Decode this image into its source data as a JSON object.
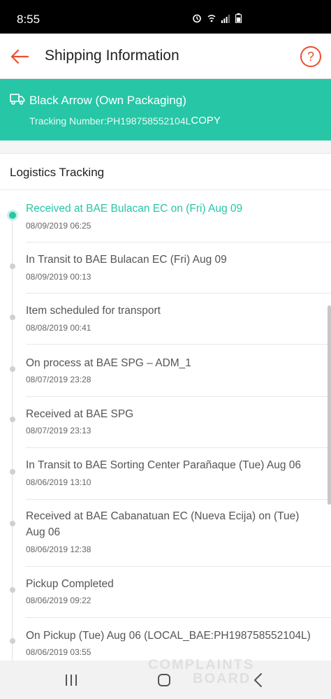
{
  "status_bar": {
    "time": "8:55",
    "icons": [
      "alarm-icon",
      "wifi-icon",
      "signal-icon",
      "battery-icon"
    ]
  },
  "header": {
    "title": "Shipping Information",
    "back_icon": "arrow-left-icon",
    "help_icon": "question-circle-icon",
    "help_label": "?"
  },
  "banner": {
    "carrier": "Black Arrow (Own Packaging)",
    "tracking_label": "Tracking Number: ",
    "tracking_number": "PH198758552104L",
    "copy_label": "COPY",
    "truck_icon": "truck-icon",
    "color": "#26c6a6"
  },
  "logistics": {
    "title": "Logistics Tracking",
    "events": [
      {
        "text": "Received at BAE Bulacan EC on (Fri) Aug 09",
        "time": "08/09/2019 06:25",
        "active": true
      },
      {
        "text": "In Transit to BAE Bulacan EC (Fri) Aug 09",
        "time": "08/09/2019 00:13",
        "active": false
      },
      {
        "text": "Item scheduled for transport",
        "time": "08/08/2019 00:41",
        "active": false
      },
      {
        "text": "On process at BAE SPG – ADM_1",
        "time": "08/07/2019 23:28",
        "active": false
      },
      {
        "text": "Received at BAE SPG",
        "time": "08/07/2019 23:13",
        "active": false
      },
      {
        "text": "In Transit to BAE Sorting Center Parañaque (Tue) Aug 06",
        "time": "08/06/2019 13:10",
        "active": false
      },
      {
        "text": "Received at BAE Cabanatuan EC (Nueva Ecija) on (Tue) Aug 06",
        "time": "08/06/2019 12:38",
        "active": false
      },
      {
        "text": "Pickup Completed",
        "time": "08/06/2019 09:22",
        "active": false
      },
      {
        "text": "On Pickup (Tue) Aug 06 (LOCAL_BAE:PH198758552104L)",
        "time": "08/06/2019 03:55",
        "active": false
      }
    ]
  },
  "watermark": {
    "line1": "COMPLAINTS",
    "line2": "BOARD"
  },
  "nav_bar": {
    "recents_icon": "recents-icon",
    "home_icon": "home-icon",
    "back_icon": "nav-back-icon"
  }
}
